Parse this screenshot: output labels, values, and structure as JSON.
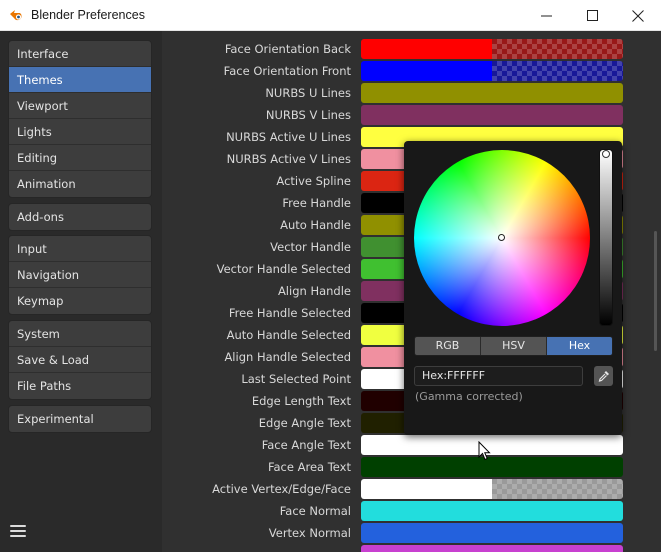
{
  "window": {
    "title": "Blender Preferences",
    "minimize_glyph": "—",
    "maximize_glyph": "☐",
    "close_glyph": "✕"
  },
  "sidebar": {
    "groups": [
      [
        "Interface",
        "Themes",
        "Viewport",
        "Lights",
        "Editing",
        "Animation"
      ],
      [
        "Add-ons"
      ],
      [
        "Input",
        "Navigation",
        "Keymap"
      ],
      [
        "System",
        "Save & Load",
        "File Paths"
      ],
      [
        "Experimental"
      ]
    ],
    "active": "Themes",
    "menu_icon": "hamburger-menu-icon"
  },
  "theme_rows": [
    {
      "label": "Face Orientation Back",
      "color": "#ff0000",
      "alpha": 0.5
    },
    {
      "label": "Face Orientation Front",
      "color": "#0000ff",
      "alpha": 0.5
    },
    {
      "label": "NURBS U Lines",
      "color": "#909000",
      "alpha": 1
    },
    {
      "label": "NURBS V Lines",
      "color": "#803060",
      "alpha": 1
    },
    {
      "label": "NURBS Active U Lines",
      "color": "#ffff40",
      "alpha": 1
    },
    {
      "label": "NURBS Active V Lines",
      "color": "#f090a0",
      "alpha": 1
    },
    {
      "label": "Active Spline",
      "color": "#db2512",
      "alpha": 1
    },
    {
      "label": "Free Handle",
      "color": "#000000",
      "alpha": 1
    },
    {
      "label": "Auto Handle",
      "color": "#909000",
      "alpha": 1
    },
    {
      "label": "Vector Handle",
      "color": "#409030",
      "alpha": 1
    },
    {
      "label": "Vector Handle Selected",
      "color": "#40c030",
      "alpha": 1
    },
    {
      "label": "Align Handle",
      "color": "#803060",
      "alpha": 1
    },
    {
      "label": "Free Handle Selected",
      "color": "#000000",
      "alpha": 1
    },
    {
      "label": "Auto Handle Selected",
      "color": "#f0ff40",
      "alpha": 1
    },
    {
      "label": "Align Handle Selected",
      "color": "#f090a0",
      "alpha": 1
    },
    {
      "label": "Last Selected Point",
      "color": "#ffffff",
      "alpha": 1
    },
    {
      "label": "Edge Length Text",
      "color": "#200000",
      "alpha": 1
    },
    {
      "label": "Edge Angle Text",
      "color": "#202000",
      "alpha": 1
    },
    {
      "label": "Face Angle Text",
      "color": "#ffffff",
      "alpha": 1
    },
    {
      "label": "Face Area Text",
      "color": "#004000",
      "alpha": 1
    },
    {
      "label": "Active Vertex/Edge/Face",
      "color": "#ffffff",
      "alpha": 0.5
    },
    {
      "label": "Face Normal",
      "color": "#22dddd",
      "alpha": 1
    },
    {
      "label": "Vertex Normal",
      "color": "#2361dd",
      "alpha": 1
    },
    {
      "label": "",
      "color": "#c840d0",
      "alpha": 1
    }
  ],
  "color_picker": {
    "modes": [
      "RGB",
      "HSV",
      "Hex"
    ],
    "active_mode": "Hex",
    "hex_value": "Hex:FFFFFF",
    "note": "(Gamma corrected)",
    "eyedropper_icon": "eyedropper-icon"
  },
  "colors": {
    "accent": "#4772b3",
    "panel": "#303030",
    "sidebar": "#2a2a2a"
  }
}
